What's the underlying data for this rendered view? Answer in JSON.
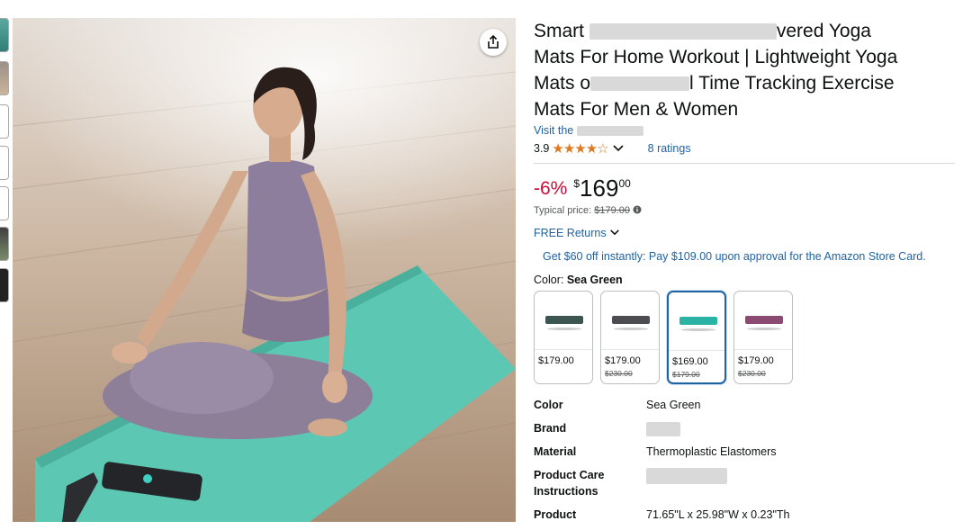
{
  "gallery": {
    "thumbnail_count": 7
  },
  "hero": {
    "share_icon": "share-icon"
  },
  "product": {
    "title_line1_start": "Smart",
    "title_line1_end": "vered Yoga",
    "title_line2": "Mats For Home Workout | Lightweight Yoga",
    "title_line3_start": "Mats o",
    "title_line3_end": "l Time Tracking Exercise",
    "title_line4": "Mats For Men & Women",
    "store_link_prefix": "Visit the",
    "rating_value": "3.9",
    "stars": "★★★★☆",
    "ratings_count": "8 ratings",
    "discount": "-6%",
    "currency": "$",
    "price_whole": "169",
    "price_fraction": "00",
    "typical_label": "Typical price:",
    "typical_price": "$179.00",
    "returns": "FREE Returns",
    "promo": "Get $60 off instantly: Pay $109.00 upon approval for the Amazon Store Card.",
    "color_label": "Color:",
    "color_selected": "Sea Green"
  },
  "swatches": [
    {
      "price": "$179.00",
      "old_price": "",
      "color": "#3d5550"
    },
    {
      "price": "$179.00",
      "old_price": "$230.00",
      "color": "#4b4d50"
    },
    {
      "price": "$169.00",
      "old_price": "$179.00",
      "color": "#2ab3a5"
    },
    {
      "price": "$179.00",
      "old_price": "$230.00",
      "color": "#8a4a72"
    }
  ],
  "specs": [
    {
      "key": "Color",
      "value": "Sea Green"
    },
    {
      "key": "Brand",
      "value": ""
    },
    {
      "key": "Material",
      "value": "Thermoplastic Elastomers"
    },
    {
      "key": "Product Care Instructions",
      "value": ""
    },
    {
      "key": "Product",
      "value": "71.65\"L x 25.98\"W x 0.23\"Th"
    }
  ],
  "colors": {
    "link": "#2162a1",
    "discount": "#cc0c39",
    "star": "#de7921",
    "selected_border": "#2162a1"
  }
}
